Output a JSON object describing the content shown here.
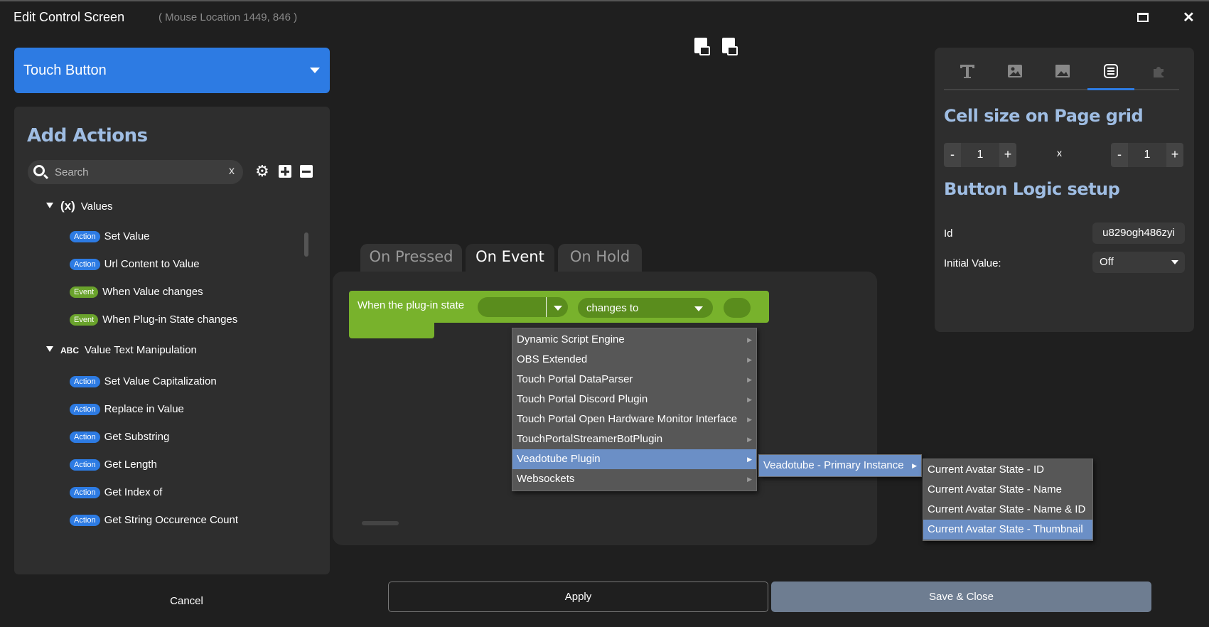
{
  "window": {
    "title": "Edit Control Screen",
    "mouse_location": "( Mouse Location 1449, 846 )"
  },
  "left": {
    "control_type": "Touch Button",
    "actions_title": "Add Actions",
    "search_placeholder": "Search",
    "search_clear": "x",
    "categories": [
      {
        "icon": "(x)",
        "label": "Values"
      },
      {
        "icon": "ABC",
        "label": "Value Text Manipulation"
      }
    ],
    "items": [
      {
        "badge": "Action",
        "label": "Set Value"
      },
      {
        "badge": "Action",
        "label": "Url Content to Value"
      },
      {
        "badge": "Event",
        "label": "When Value changes"
      },
      {
        "badge": "Event",
        "label": "When Plug-in State changes"
      },
      {
        "badge": "Action",
        "label": "Set Value Capitalization"
      },
      {
        "badge": "Action",
        "label": "Replace in Value"
      },
      {
        "badge": "Action",
        "label": "Get Substring"
      },
      {
        "badge": "Action",
        "label": "Get Length"
      },
      {
        "badge": "Action",
        "label": "Get Index of"
      },
      {
        "badge": "Action",
        "label": "Get String Occurence Count"
      }
    ]
  },
  "center": {
    "tabs": [
      "On Pressed",
      "On Event",
      "On Hold"
    ],
    "active_tab": "On Event",
    "block": {
      "label": "When the plug-in state",
      "condition": "changes to"
    },
    "menu_plugins": [
      "Dynamic Script Engine",
      "OBS Extended",
      "Touch Portal DataParser",
      "Touch Portal Discord Plugin",
      "Touch Portal Open Hardware Monitor Interface",
      "TouchPortalStreamerBotPlugin",
      "Veadotube Plugin",
      "Websockets"
    ],
    "menu_instances": [
      "Veadotube - Primary Instance"
    ],
    "menu_states": [
      "Current Avatar State - ID",
      "Current Avatar State - Name",
      "Current Avatar State - Name & ID",
      "Current Avatar State - Thumbnail"
    ]
  },
  "right": {
    "cell_size_title": "Cell size on Page grid",
    "cell_width": "1",
    "cell_height": "1",
    "cell_separator": "x",
    "stepper_minus": "-",
    "stepper_plus": "+",
    "logic_title": "Button Logic setup",
    "id_label": "Id",
    "id_value": "u829ogh486zyi",
    "initial_label": "Initial Value:",
    "initial_value": "Off"
  },
  "footer": {
    "cancel": "Cancel",
    "apply": "Apply",
    "save": "Save & Close"
  },
  "colors": {
    "accent": "#2d7be3",
    "event_green": "#78b22c",
    "heading": "#9fbde3",
    "menu_highlight": "#6b8fc6"
  }
}
